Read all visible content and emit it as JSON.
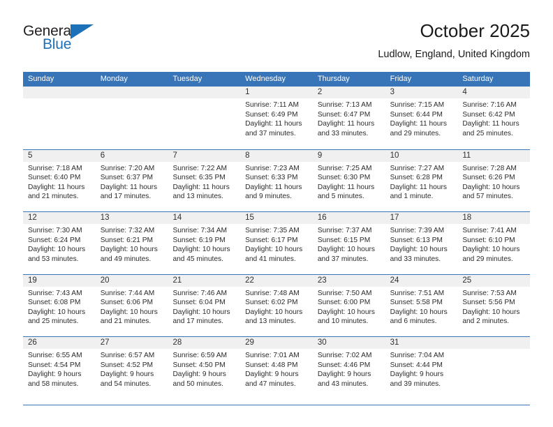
{
  "logo": {
    "text_primary": "General",
    "text_secondary": "Blue",
    "flag_icon": "flag-triangle-icon",
    "color_primary": "#231f20",
    "color_secondary": "#1d71b8"
  },
  "header": {
    "title": "October 2025",
    "subtitle": "Ludlow, England, United Kingdom"
  },
  "theme": {
    "header_band": "#3875b8",
    "day_band": "#f0f0f0",
    "grid_line": "#3875b8",
    "text": "#2b2b2b"
  },
  "weekdays": [
    "Sunday",
    "Monday",
    "Tuesday",
    "Wednesday",
    "Thursday",
    "Friday",
    "Saturday"
  ],
  "weeks": [
    [
      {
        "day": "",
        "empty": true,
        "lines": []
      },
      {
        "day": "",
        "empty": true,
        "lines": []
      },
      {
        "day": "",
        "empty": true,
        "lines": []
      },
      {
        "day": "1",
        "empty": false,
        "lines": [
          "Sunrise: 7:11 AM",
          "Sunset: 6:49 PM",
          "Daylight: 11 hours",
          "and 37 minutes."
        ]
      },
      {
        "day": "2",
        "empty": false,
        "lines": [
          "Sunrise: 7:13 AM",
          "Sunset: 6:47 PM",
          "Daylight: 11 hours",
          "and 33 minutes."
        ]
      },
      {
        "day": "3",
        "empty": false,
        "lines": [
          "Sunrise: 7:15 AM",
          "Sunset: 6:44 PM",
          "Daylight: 11 hours",
          "and 29 minutes."
        ]
      },
      {
        "day": "4",
        "empty": false,
        "lines": [
          "Sunrise: 7:16 AM",
          "Sunset: 6:42 PM",
          "Daylight: 11 hours",
          "and 25 minutes."
        ]
      }
    ],
    [
      {
        "day": "5",
        "empty": false,
        "lines": [
          "Sunrise: 7:18 AM",
          "Sunset: 6:40 PM",
          "Daylight: 11 hours",
          "and 21 minutes."
        ]
      },
      {
        "day": "6",
        "empty": false,
        "lines": [
          "Sunrise: 7:20 AM",
          "Sunset: 6:37 PM",
          "Daylight: 11 hours",
          "and 17 minutes."
        ]
      },
      {
        "day": "7",
        "empty": false,
        "lines": [
          "Sunrise: 7:22 AM",
          "Sunset: 6:35 PM",
          "Daylight: 11 hours",
          "and 13 minutes."
        ]
      },
      {
        "day": "8",
        "empty": false,
        "lines": [
          "Sunrise: 7:23 AM",
          "Sunset: 6:33 PM",
          "Daylight: 11 hours",
          "and 9 minutes."
        ]
      },
      {
        "day": "9",
        "empty": false,
        "lines": [
          "Sunrise: 7:25 AM",
          "Sunset: 6:30 PM",
          "Daylight: 11 hours",
          "and 5 minutes."
        ]
      },
      {
        "day": "10",
        "empty": false,
        "lines": [
          "Sunrise: 7:27 AM",
          "Sunset: 6:28 PM",
          "Daylight: 11 hours",
          "and 1 minute."
        ]
      },
      {
        "day": "11",
        "empty": false,
        "lines": [
          "Sunrise: 7:28 AM",
          "Sunset: 6:26 PM",
          "Daylight: 10 hours",
          "and 57 minutes."
        ]
      }
    ],
    [
      {
        "day": "12",
        "empty": false,
        "lines": [
          "Sunrise: 7:30 AM",
          "Sunset: 6:24 PM",
          "Daylight: 10 hours",
          "and 53 minutes."
        ]
      },
      {
        "day": "13",
        "empty": false,
        "lines": [
          "Sunrise: 7:32 AM",
          "Sunset: 6:21 PM",
          "Daylight: 10 hours",
          "and 49 minutes."
        ]
      },
      {
        "day": "14",
        "empty": false,
        "lines": [
          "Sunrise: 7:34 AM",
          "Sunset: 6:19 PM",
          "Daylight: 10 hours",
          "and 45 minutes."
        ]
      },
      {
        "day": "15",
        "empty": false,
        "lines": [
          "Sunrise: 7:35 AM",
          "Sunset: 6:17 PM",
          "Daylight: 10 hours",
          "and 41 minutes."
        ]
      },
      {
        "day": "16",
        "empty": false,
        "lines": [
          "Sunrise: 7:37 AM",
          "Sunset: 6:15 PM",
          "Daylight: 10 hours",
          "and 37 minutes."
        ]
      },
      {
        "day": "17",
        "empty": false,
        "lines": [
          "Sunrise: 7:39 AM",
          "Sunset: 6:13 PM",
          "Daylight: 10 hours",
          "and 33 minutes."
        ]
      },
      {
        "day": "18",
        "empty": false,
        "lines": [
          "Sunrise: 7:41 AM",
          "Sunset: 6:10 PM",
          "Daylight: 10 hours",
          "and 29 minutes."
        ]
      }
    ],
    [
      {
        "day": "19",
        "empty": false,
        "lines": [
          "Sunrise: 7:43 AM",
          "Sunset: 6:08 PM",
          "Daylight: 10 hours",
          "and 25 minutes."
        ]
      },
      {
        "day": "20",
        "empty": false,
        "lines": [
          "Sunrise: 7:44 AM",
          "Sunset: 6:06 PM",
          "Daylight: 10 hours",
          "and 21 minutes."
        ]
      },
      {
        "day": "21",
        "empty": false,
        "lines": [
          "Sunrise: 7:46 AM",
          "Sunset: 6:04 PM",
          "Daylight: 10 hours",
          "and 17 minutes."
        ]
      },
      {
        "day": "22",
        "empty": false,
        "lines": [
          "Sunrise: 7:48 AM",
          "Sunset: 6:02 PM",
          "Daylight: 10 hours",
          "and 13 minutes."
        ]
      },
      {
        "day": "23",
        "empty": false,
        "lines": [
          "Sunrise: 7:50 AM",
          "Sunset: 6:00 PM",
          "Daylight: 10 hours",
          "and 10 minutes."
        ]
      },
      {
        "day": "24",
        "empty": false,
        "lines": [
          "Sunrise: 7:51 AM",
          "Sunset: 5:58 PM",
          "Daylight: 10 hours",
          "and 6 minutes."
        ]
      },
      {
        "day": "25",
        "empty": false,
        "lines": [
          "Sunrise: 7:53 AM",
          "Sunset: 5:56 PM",
          "Daylight: 10 hours",
          "and 2 minutes."
        ]
      }
    ],
    [
      {
        "day": "26",
        "empty": false,
        "lines": [
          "Sunrise: 6:55 AM",
          "Sunset: 4:54 PM",
          "Daylight: 9 hours",
          "and 58 minutes."
        ]
      },
      {
        "day": "27",
        "empty": false,
        "lines": [
          "Sunrise: 6:57 AM",
          "Sunset: 4:52 PM",
          "Daylight: 9 hours",
          "and 54 minutes."
        ]
      },
      {
        "day": "28",
        "empty": false,
        "lines": [
          "Sunrise: 6:59 AM",
          "Sunset: 4:50 PM",
          "Daylight: 9 hours",
          "and 50 minutes."
        ]
      },
      {
        "day": "29",
        "empty": false,
        "lines": [
          "Sunrise: 7:01 AM",
          "Sunset: 4:48 PM",
          "Daylight: 9 hours",
          "and 47 minutes."
        ]
      },
      {
        "day": "30",
        "empty": false,
        "lines": [
          "Sunrise: 7:02 AM",
          "Sunset: 4:46 PM",
          "Daylight: 9 hours",
          "and 43 minutes."
        ]
      },
      {
        "day": "31",
        "empty": false,
        "lines": [
          "Sunrise: 7:04 AM",
          "Sunset: 4:44 PM",
          "Daylight: 9 hours",
          "and 39 minutes."
        ]
      },
      {
        "day": "",
        "empty": true,
        "lines": []
      }
    ]
  ]
}
